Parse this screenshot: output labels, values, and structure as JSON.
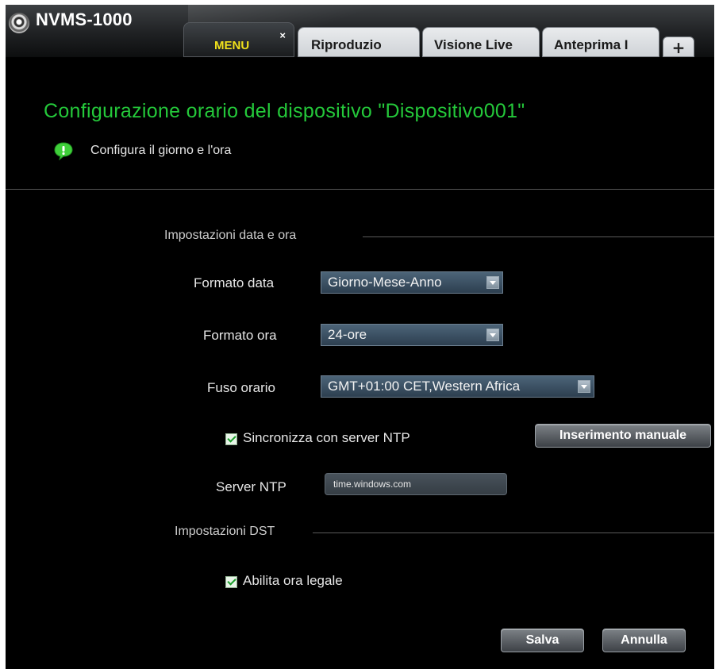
{
  "app": {
    "title": "NVMS-1000"
  },
  "tabs": [
    {
      "label": "MENU",
      "active": true
    },
    {
      "label": "Riproduzio"
    },
    {
      "label": "Visione Live"
    },
    {
      "label": "Anteprima I"
    }
  ],
  "tab_add_label": "+",
  "tab_close_label": "×",
  "page": {
    "title": "Configurazione orario del dispositivo \"Dispositivo001\"",
    "subtitle": "Configura il giorno e l'ora"
  },
  "datetime_section": {
    "title": "Impostazioni data e ora",
    "date_format": {
      "label": "Formato data",
      "value": "Giorno-Mese-Anno"
    },
    "time_format": {
      "label": "Formato ora",
      "value": "24-ore"
    },
    "timezone": {
      "label": "Fuso orario",
      "value": "GMT+01:00 CET,Western Africa"
    },
    "ntp_sync": {
      "label": "Sincronizza con server NTP",
      "checked": true
    },
    "manual_button": "Inserimento manuale",
    "ntp_server": {
      "label": "Server NTP",
      "value": "time.windows.com"
    }
  },
  "dst_section": {
    "title": "Impostazioni DST",
    "enable_dst": {
      "label": "Abilita ora legale",
      "checked": true
    }
  },
  "footer": {
    "save_label": "Salva",
    "cancel_label": "Annulla"
  },
  "colors": {
    "accent_green": "#24c83a",
    "active_tab_text": "#f2e21b",
    "background": "#000000"
  }
}
